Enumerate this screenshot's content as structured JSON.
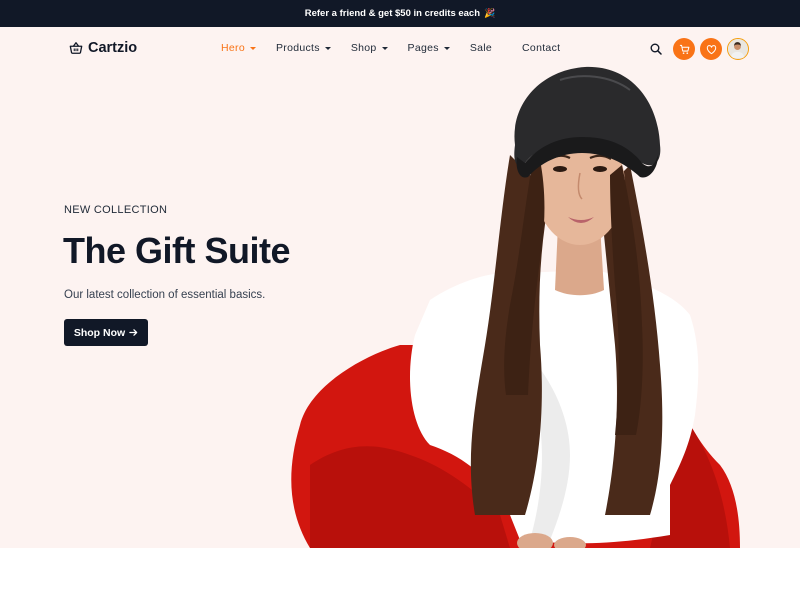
{
  "announcement": {
    "text": "Refer a friend & get $50 in credits each",
    "emoji": "🎉"
  },
  "brand": {
    "name": "Cartzio",
    "icon": "basket-icon"
  },
  "nav": {
    "items": [
      {
        "label": "Hero",
        "active": true,
        "dropdown": true
      },
      {
        "label": "Products",
        "dropdown": true
      },
      {
        "label": "Shop",
        "dropdown": true
      },
      {
        "label": "Pages",
        "dropdown": true
      },
      {
        "label": "Sale",
        "dropdown": false
      },
      {
        "label": "Contact",
        "dropdown": false
      }
    ]
  },
  "header_actions": {
    "search": "search-icon",
    "cart": "cart-icon",
    "wishlist": "heart-icon",
    "profile": "user-avatar"
  },
  "hero": {
    "eyebrow": "NEW COLLECTION",
    "title": "The Gift Suite",
    "subtitle": "Our latest collection of essential basics.",
    "cta": "Shop Now",
    "cta_icon": "arrow-right-icon"
  },
  "colors": {
    "accent": "#f97316",
    "dark": "#111827",
    "hero_bg": "#fdf3f1"
  }
}
